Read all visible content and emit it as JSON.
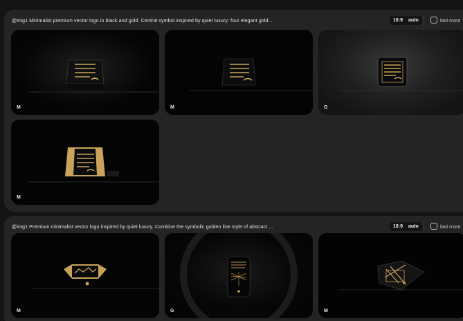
{
  "groups": [
    {
      "prompt": "@img1 Minimalist premium vector logo in black and gold. Central symbol inspired by quiet luxury: four elegant gold...",
      "ratio": "16:9",
      "mode": "auto",
      "last_label": "last mont",
      "images": [
        {
          "badge": "M",
          "model_icon": "m-logo-icon",
          "style": "gold-lines-dark-cube"
        },
        {
          "badge": "M",
          "model_icon": "m-logo-icon",
          "style": "gold-lines-black-cube"
        },
        {
          "badge": "G",
          "model_icon": "g-logo-icon",
          "style": "framed-gold-lines"
        },
        {
          "badge": "M",
          "model_icon": "m-logo-icon",
          "style": "gold-panel-cube"
        }
      ]
    },
    {
      "prompt": "@img1 Premium minimalist vector logo inspired by quiet luxury. Combine the symbolic golden line style of abstract ...",
      "ratio": "16:9",
      "mode": "auto",
      "last_label": "last mont",
      "images": [
        {
          "badge": "M",
          "model_icon": "m-logo-icon",
          "style": "gold-abstract-bar"
        },
        {
          "badge": "G",
          "model_icon": "g-logo-icon",
          "style": "dark-card-lines"
        },
        {
          "badge": "M",
          "model_icon": "m-logo-icon",
          "style": "cube-abstract-gold"
        }
      ]
    }
  ],
  "colors": {
    "gold": "#c9a35b",
    "panel": "#242424",
    "background": "#141414"
  }
}
